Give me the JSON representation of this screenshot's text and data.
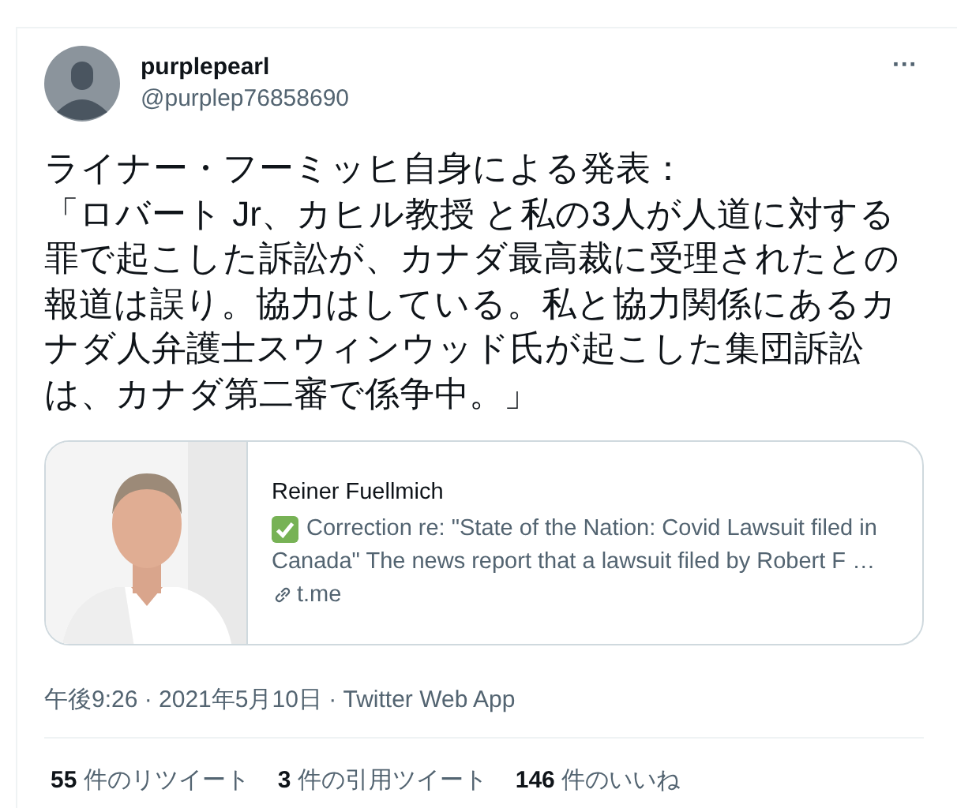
{
  "author": {
    "name": "purplepearl",
    "handle": "@purplep76858690"
  },
  "more": "···",
  "text": [
    "ライナー・フーミッヒ自身による発表：",
    "「ロバート Jr、カヒル教授 と私の3人が人道に対する罪で起こした訴訟が、カナダ最高裁に受理されたとの報道は誤り。協力はしている。私と協力関係にあるカナダ人弁護士スウィンウッド氏が起こした集団訴訟は、カナダ第二審で係争中。」"
  ],
  "card": {
    "image": {
      "kind": "picture"
    },
    "title": "Reiner Fuellmich",
    "description_lines": [
      "Correction re: \"State of the Nation: Covid Lawsuit filed in",
      "Canada\" The news report that a lawsuit filed by Robert F …"
    ],
    "domain": "t.me"
  },
  "timestamp": "午後9:26 · 2021年5月10日 · Twitter Web App",
  "stats": [
    {
      "count": "55",
      "label": "件のリツイート"
    },
    {
      "count": "3",
      "label": "件の引用ツイート"
    },
    {
      "count": "146",
      "label": "件のいいね"
    }
  ]
}
